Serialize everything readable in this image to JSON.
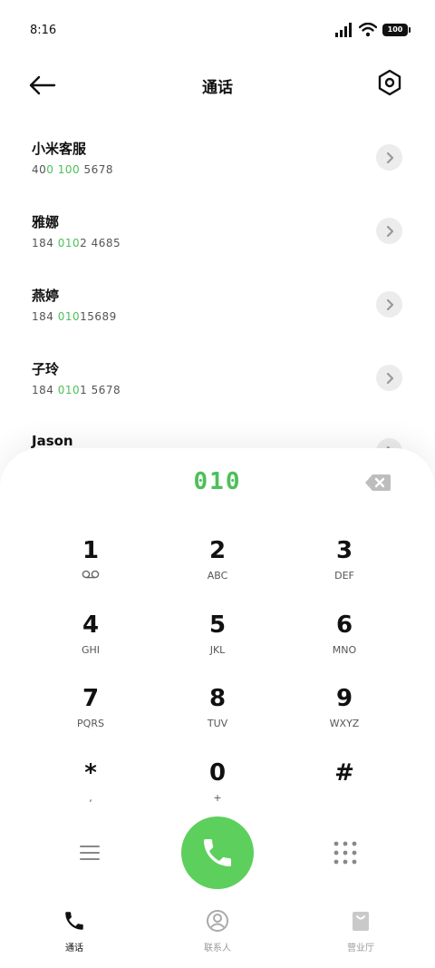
{
  "status_bar": {
    "time": "8:16",
    "battery": "100"
  },
  "header": {
    "title": "通话"
  },
  "contacts": [
    {
      "name": "小米客服",
      "number_parts": [
        "40",
        "0 100",
        " 5678"
      ]
    },
    {
      "name": "雅娜",
      "number_parts": [
        "184 ",
        "010",
        "2 4685"
      ]
    },
    {
      "name": "燕婷",
      "number_parts": [
        "184 ",
        "010",
        "15689"
      ]
    },
    {
      "name": "子玲",
      "number_parts": [
        "184 ",
        "010",
        "1 5678"
      ]
    },
    {
      "name": "Jason",
      "number_parts": [
        "",
        "",
        ""
      ]
    }
  ],
  "dialpad": {
    "input": "010",
    "keys": [
      {
        "digit": "1",
        "letters": ""
      },
      {
        "digit": "2",
        "letters": "ABC"
      },
      {
        "digit": "3",
        "letters": "DEF"
      },
      {
        "digit": "4",
        "letters": "GHI"
      },
      {
        "digit": "5",
        "letters": "JKL"
      },
      {
        "digit": "6",
        "letters": "MNO"
      },
      {
        "digit": "7",
        "letters": "PQRS"
      },
      {
        "digit": "8",
        "letters": "TUV"
      },
      {
        "digit": "9",
        "letters": "WXYZ"
      },
      {
        "digit": "*",
        "letters": ","
      },
      {
        "digit": "0",
        "letters": "+"
      },
      {
        "digit": "#",
        "letters": ""
      }
    ]
  },
  "bottom_nav": {
    "items": [
      {
        "label": "通话",
        "icon": "phone-icon",
        "active": true
      },
      {
        "label": "联系人",
        "icon": "contacts-icon",
        "active": false
      },
      {
        "label": "营业厅",
        "icon": "store-bag-icon",
        "active": false
      }
    ]
  },
  "colors": {
    "accent_green": "#4cc05a",
    "call_button": "#5ccf5c",
    "detail_button_bg": "#ececec"
  }
}
